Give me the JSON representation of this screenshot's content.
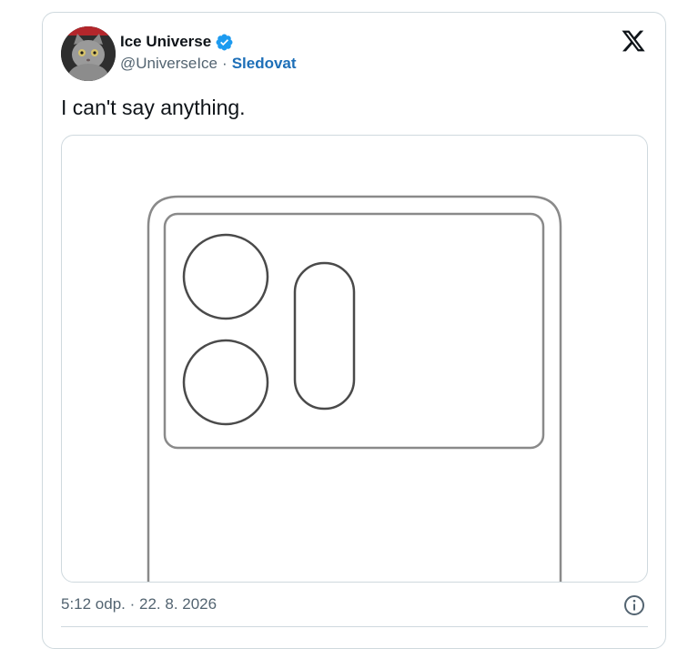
{
  "tweet": {
    "author_name": "Ice Universe",
    "author_handle": "@UniverseIce",
    "separator": "·",
    "follow_label": "Sledovat",
    "text": "I can't say anything.",
    "timestamp": "5:12 odp. · 22. 8. 2026"
  },
  "icons": {
    "verified": "verified-badge-icon",
    "platform": "x-logo-icon",
    "info": "info-icon"
  },
  "colors": {
    "link": "#1d6fb8",
    "verified": "#1d9bf0",
    "text": "#0f1419",
    "secondary": "#536471",
    "border": "#cfd9de"
  }
}
